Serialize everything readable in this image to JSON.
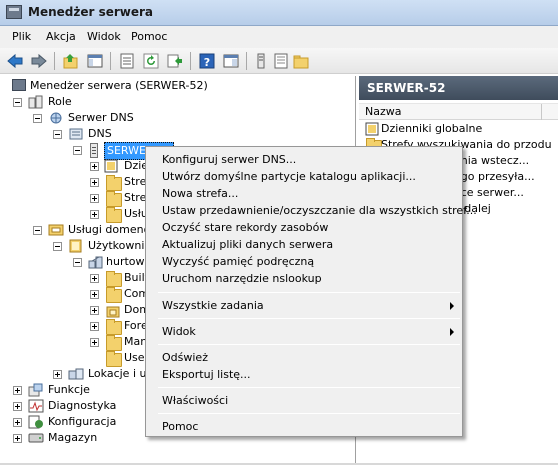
{
  "window": {
    "title": "Menedżer serwera"
  },
  "menubar": {
    "items": [
      "Plik",
      "Akcja",
      "Widok",
      "Pomoc"
    ]
  },
  "toolbar": {
    "buttons": [
      "back-arrow-icon",
      "forward-arrow-icon",
      "up-folder-icon",
      "show-hide-tree-icon",
      "properties-icon",
      "refresh-icon",
      "export-list-icon",
      "help-icon",
      "console-icon",
      "server-icon",
      "list-icon",
      "folder-icon"
    ]
  },
  "tree": {
    "root": "Menedżer serwera (SERWER-52)",
    "roles": "Role",
    "dns_server": "Serwer DNS",
    "dns": "DNS",
    "server_node": "SERWER-52",
    "server_children": [
      "Dzien",
      "Stre",
      "Stre",
      "Usłu"
    ],
    "ad_services": "Usługi domenow",
    "users_computers": "Użytkownicy",
    "domain": "hurtown",
    "domain_children": [
      "Built",
      "Com",
      "Dom",
      "Fore",
      "Man",
      "Use"
    ],
    "locations": "Lokacje i us",
    "features": "Funkcje",
    "diagnostics": "Diagnostyka",
    "configuration": "Konfiguracja",
    "storage": "Magazyn"
  },
  "right": {
    "header": "SERWER-52",
    "column_name": "Nazwa",
    "rows": [
      "Dzienniki globalne",
      "Strefy wyszukiwania do przodu",
      "ania wstecz...",
      "ego przesyła...",
      "ące serwer...",
      "a dalej"
    ]
  },
  "context_menu": {
    "items": [
      "Konfiguruj serwer DNS...",
      "Utwórz domyślne partycje katalogu aplikacji...",
      "Nowa strefa...",
      "Ustaw przedawnienie/oczyszczanie dla wszystkich stref...",
      "Oczyść stare rekordy zasobów",
      "Aktualizuj pliki danych serwera",
      "Wyczyść pamięć podręczną",
      "Uruchom narzędzie nslookup"
    ],
    "all_tasks": "Wszystkie zadania",
    "view": "Widok",
    "refresh": "Odśwież",
    "export": "Eksportuj listę...",
    "properties": "Właściwości",
    "help": "Pomoc"
  }
}
